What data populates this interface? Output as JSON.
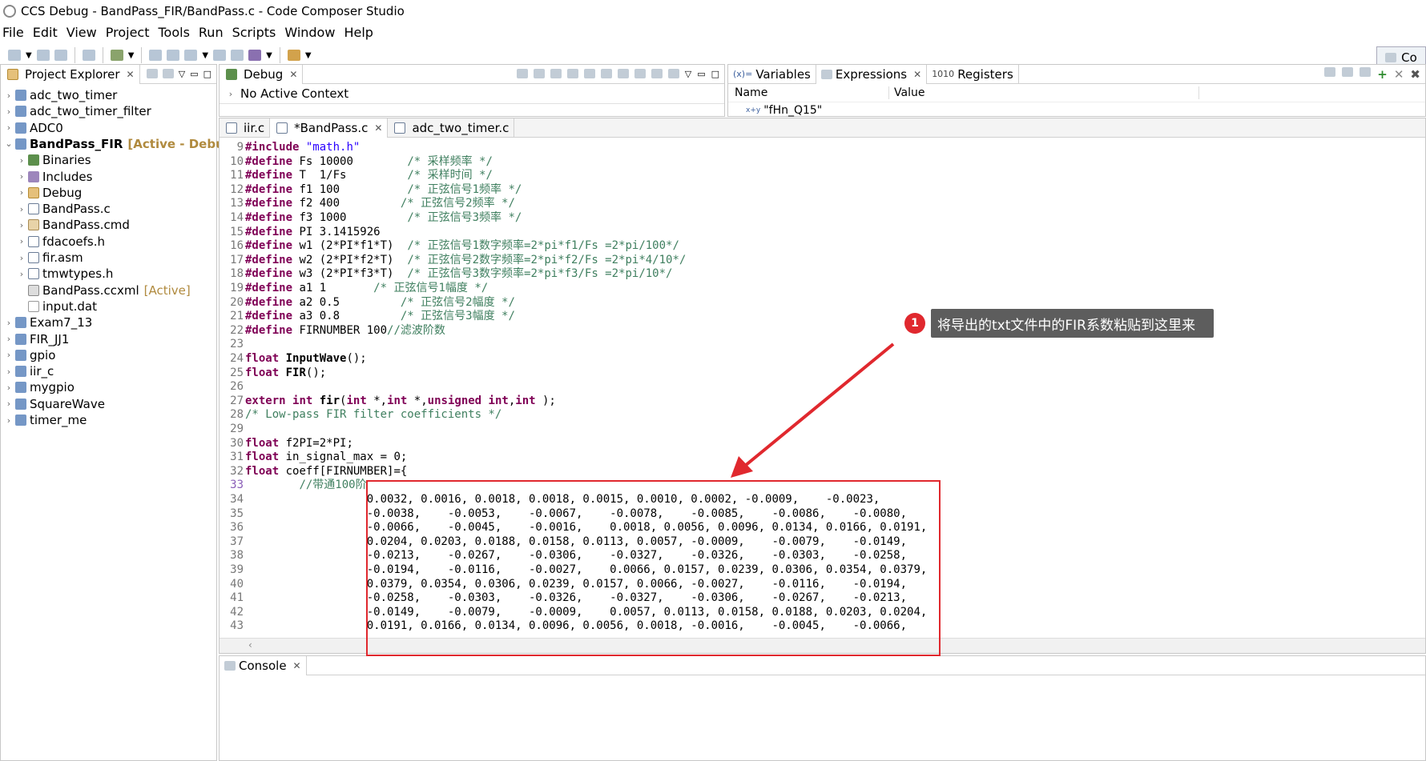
{
  "window": {
    "title": "CCS Debug - BandPass_FIR/BandPass.c - Code Composer Studio"
  },
  "menu": [
    "File",
    "Edit",
    "View",
    "Project",
    "Tools",
    "Run",
    "Scripts",
    "Window",
    "Help"
  ],
  "perspective": {
    "label": "Co"
  },
  "project_explorer": {
    "title": "Project Explorer",
    "items": [
      {
        "label": "adc_two_timer",
        "level": 0,
        "expanded": false,
        "icon": "project-icon"
      },
      {
        "label": "adc_two_timer_filter",
        "level": 0,
        "expanded": false,
        "icon": "project-icon"
      },
      {
        "label": "ADC0",
        "level": 0,
        "expanded": false,
        "icon": "project-icon"
      },
      {
        "label": "BandPass_FIR",
        "level": 0,
        "expanded": true,
        "icon": "project-icon",
        "suffix": "[Active - Debug]",
        "bold": true
      },
      {
        "label": "Binaries",
        "level": 1,
        "expanded": false,
        "icon": "binaries-icon"
      },
      {
        "label": "Includes",
        "level": 1,
        "expanded": false,
        "icon": "includes-icon"
      },
      {
        "label": "Debug",
        "level": 1,
        "expanded": false,
        "icon": "folder-icon"
      },
      {
        "label": "BandPass.c",
        "level": 1,
        "expanded": false,
        "icon": "c-file-icon"
      },
      {
        "label": "BandPass.cmd",
        "level": 1,
        "expanded": false,
        "icon": "cmd-file-icon"
      },
      {
        "label": "fdacoefs.h",
        "level": 1,
        "expanded": false,
        "icon": "h-file-icon"
      },
      {
        "label": "fir.asm",
        "level": 1,
        "expanded": false,
        "icon": "asm-file-icon"
      },
      {
        "label": "tmwtypes.h",
        "level": 1,
        "expanded": false,
        "icon": "h-file-icon"
      },
      {
        "label": "BandPass.ccxml",
        "level": 1,
        "noexpander": true,
        "icon": "ccxml-file-icon",
        "suffix": "[Active]"
      },
      {
        "label": "input.dat",
        "level": 1,
        "noexpander": true,
        "icon": "dat-file-icon"
      },
      {
        "label": "Exam7_13",
        "level": 0,
        "expanded": false,
        "icon": "project-icon"
      },
      {
        "label": "FIR_JJ1",
        "level": 0,
        "expanded": false,
        "icon": "project-icon"
      },
      {
        "label": "gpio",
        "level": 0,
        "expanded": false,
        "icon": "project-icon"
      },
      {
        "label": "iir_c",
        "level": 0,
        "expanded": false,
        "icon": "project-icon"
      },
      {
        "label": "mygpio",
        "level": 0,
        "expanded": false,
        "icon": "project-icon"
      },
      {
        "label": "SquareWave",
        "level": 0,
        "expanded": false,
        "icon": "project-icon"
      },
      {
        "label": "timer_me",
        "level": 0,
        "expanded": false,
        "icon": "project-icon"
      }
    ]
  },
  "debug_view": {
    "title": "Debug",
    "context": "No Active Context"
  },
  "expressions_view": {
    "tabs": [
      "Variables",
      "Expressions",
      "Registers"
    ],
    "columns": [
      "Name",
      "Value"
    ],
    "rows": [
      {
        "name": "\"fHn_Q15\"",
        "value": ""
      }
    ]
  },
  "editor": {
    "tabs": [
      "iir.c",
      "*BandPass.c",
      "adc_two_timer.c"
    ],
    "lines": [
      {
        "n": "9",
        "html": "<span class=\"kw\">#include</span> <span class=\"str\">\"math.h\"</span>"
      },
      {
        "n": "10",
        "html": "<span class=\"kw\">#define</span> Fs 10000        <span class=\"cm\">/* 采样频率 */</span>"
      },
      {
        "n": "11",
        "html": "<span class=\"kw\">#define</span> T  1/Fs         <span class=\"cm\">/* 采样时间 */</span>"
      },
      {
        "n": "12",
        "html": "<span class=\"kw\">#define</span> f1 100          <span class=\"cm\">/* 正弦信号1频率 */</span>"
      },
      {
        "n": "13",
        "html": "<span class=\"kw\">#define</span> f2 400         <span class=\"cm\">/* 正弦信号2频率 */</span>"
      },
      {
        "n": "14",
        "html": "<span class=\"kw\">#define</span> f3 1000         <span class=\"cm\">/* 正弦信号3频率 */</span>"
      },
      {
        "n": "15",
        "html": "<span class=\"kw\">#define</span> PI 3.1415926"
      },
      {
        "n": "16",
        "html": "<span class=\"kw\">#define</span> w1 (2*PI*f1*T)  <span class=\"cm\">/* 正弦信号1数字频率=2*pi*f1/Fs =2*pi/100*/</span>"
      },
      {
        "n": "17",
        "html": "<span class=\"kw\">#define</span> w2 (2*PI*f2*T)  <span class=\"cm\">/* 正弦信号2数字频率=2*pi*f2/Fs =2*pi*4/10*/</span>"
      },
      {
        "n": "18",
        "html": "<span class=\"kw\">#define</span> w3 (2*PI*f3*T)  <span class=\"cm\">/* 正弦信号3数字频率=2*pi*f3/Fs =2*pi/10*/</span>"
      },
      {
        "n": "19",
        "html": "<span class=\"kw\">#define</span> a1 1       <span class=\"cm\">/* 正弦信号1幅度 */</span>"
      },
      {
        "n": "20",
        "html": "<span class=\"kw\">#define</span> a2 0.5         <span class=\"cm\">/* 正弦信号2幅度 */</span>"
      },
      {
        "n": "21",
        "html": "<span class=\"kw\">#define</span> a3 0.8         <span class=\"cm\">/* 正弦信号3幅度 */</span>"
      },
      {
        "n": "22",
        "html": "<span class=\"kw\">#define</span> FIRNUMBER 100<span class=\"cm\">//滤波阶数</span>"
      },
      {
        "n": "23",
        "html": ""
      },
      {
        "n": "24",
        "html": "<span class=\"kw\">float</span> <span class=\"fn\">InputWave</span>();"
      },
      {
        "n": "25",
        "html": "<span class=\"kw\">float</span> <span class=\"fn\">FIR</span>();"
      },
      {
        "n": "26",
        "html": ""
      },
      {
        "n": "27",
        "html": "<span class=\"kw\">extern</span> <span class=\"kw\">int</span> <span class=\"fn\">fir</span>(<span class=\"kw\">int</span> *,<span class=\"kw\">int</span> *,<span class=\"kw\">unsigned</span> <span class=\"kw\">int</span>,<span class=\"kw\">int</span> );"
      },
      {
        "n": "28",
        "html": "<span class=\"cm\">/* Low-pass FIR filter coefficients */</span>"
      },
      {
        "n": "29",
        "html": ""
      },
      {
        "n": "30",
        "html": "<span class=\"kw\">float</span> f2PI=2*PI;"
      },
      {
        "n": "31",
        "html": "<span class=\"kw\">float</span> in_signal_max = 0;"
      },
      {
        "n": "32",
        "html": "<span class=\"kw\">float</span> coeff[FIRNUMBER]={"
      },
      {
        "n": "33",
        "html": "        <span class=\"cm\">//带通100阶</span>",
        "mark": true
      },
      {
        "n": "34",
        "html": "                  0.0032, 0.0016, 0.0018, 0.0018, 0.0015, 0.0010, 0.0002, -0.0009,    -0.0023,"
      },
      {
        "n": "35",
        "html": "                  -0.0038,    -0.0053,    -0.0067,    -0.0078,    -0.0085,    -0.0086,    -0.0080,"
      },
      {
        "n": "36",
        "html": "                  -0.0066,    -0.0045,    -0.0016,    0.0018, 0.0056, 0.0096, 0.0134, 0.0166, 0.0191,"
      },
      {
        "n": "37",
        "html": "                  0.0204, 0.0203, 0.0188, 0.0158, 0.0113, 0.0057, -0.0009,    -0.0079,    -0.0149,"
      },
      {
        "n": "38",
        "html": "                  -0.0213,    -0.0267,    -0.0306,    -0.0327,    -0.0326,    -0.0303,    -0.0258,"
      },
      {
        "n": "39",
        "html": "                  -0.0194,    -0.0116,    -0.0027,    0.0066, 0.0157, 0.0239, 0.0306, 0.0354, 0.0379,"
      },
      {
        "n": "40",
        "html": "                  0.0379, 0.0354, 0.0306, 0.0239, 0.0157, 0.0066, -0.0027,    -0.0116,    -0.0194,"
      },
      {
        "n": "41",
        "html": "                  -0.0258,    -0.0303,    -0.0326,    -0.0327,    -0.0306,    -0.0267,    -0.0213,"
      },
      {
        "n": "42",
        "html": "                  -0.0149,    -0.0079,    -0.0009,    0.0057, 0.0113, 0.0158, 0.0188, 0.0203, 0.0204,"
      },
      {
        "n": "43",
        "html": "                  0.0191, 0.0166, 0.0134, 0.0096, 0.0056, 0.0018, -0.0016,    -0.0045,    -0.0066,"
      }
    ]
  },
  "console_view": {
    "title": "Console"
  },
  "annotation": {
    "badge": "1",
    "text": "将导出的txt文件中的FIR系数粘贴到这里来"
  }
}
